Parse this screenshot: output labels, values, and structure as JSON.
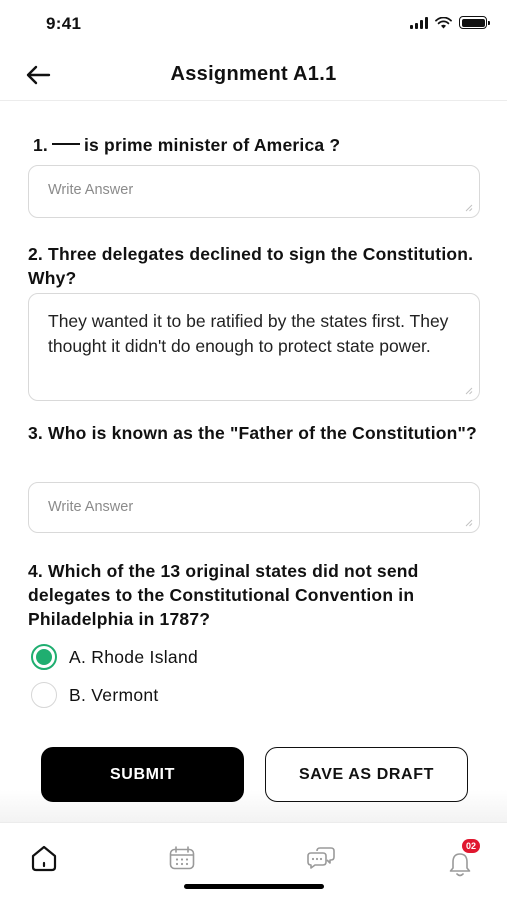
{
  "status_bar": {
    "time": "9:41"
  },
  "header": {
    "title": "Assignment A1.1"
  },
  "questions": [
    {
      "number": "1.",
      "text": "is prime minister of America ?",
      "answer_placeholder": "Write Answer",
      "answer_value": ""
    },
    {
      "text": "2. Three delegates declined to sign the Constitution. Why?",
      "answer_value": "They wanted it to be ratified by the states first. They thought it didn't do enough to protect state power."
    },
    {
      "text": "3. Who is known as the \"Father of the Constitution\"?",
      "answer_placeholder": "Write Answer",
      "answer_value": ""
    },
    {
      "text": "4. Which of the 13 original states did not send delegates to the Constitutional Convention in Philadelphia in 1787?",
      "options": [
        {
          "label": "A. Rhode Island",
          "selected": true
        },
        {
          "label": "B. Vermont",
          "selected": false
        }
      ]
    }
  ],
  "actions": {
    "submit_label": "SUBMIT",
    "draft_label": "SAVE AS DRAFT"
  },
  "tab_bar": {
    "items": [
      {
        "icon": "home-icon"
      },
      {
        "icon": "calendar-icon"
      },
      {
        "icon": "chat-icon"
      },
      {
        "icon": "bell-icon",
        "badge": "02"
      }
    ]
  },
  "colors": {
    "accent": "#1fae70",
    "badge": "#e0172f",
    "primary_button": "#000000"
  }
}
